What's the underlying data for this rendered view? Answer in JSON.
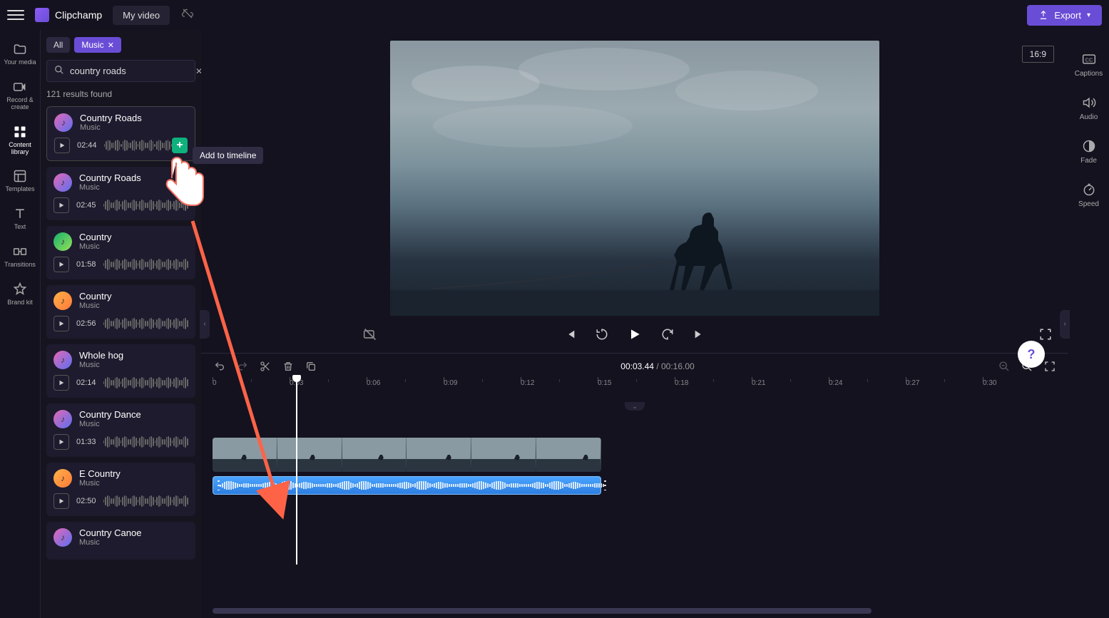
{
  "header": {
    "brand": "Clipchamp",
    "project": "My video",
    "export_label": "Export"
  },
  "left_nav": [
    {
      "label": "Your media",
      "icon": "folder"
    },
    {
      "label": "Record & create",
      "icon": "record"
    },
    {
      "label": "Content library",
      "icon": "library",
      "active": true
    },
    {
      "label": "Templates",
      "icon": "templates"
    },
    {
      "label": "Text",
      "icon": "text"
    },
    {
      "label": "Transitions",
      "icon": "transitions"
    },
    {
      "label": "Brand kit",
      "icon": "brandkit"
    }
  ],
  "library": {
    "chips": {
      "all": "All",
      "music": "Music"
    },
    "search_value": "country roads",
    "results_text": "121 results found",
    "tooltip": "Add to timeline",
    "items": [
      {
        "title": "Country Roads",
        "sub": "Music",
        "duration": "02:44",
        "color": "linear-gradient(135deg,#e568b5,#5b6ff0)",
        "highlighted": true,
        "add_btn": true
      },
      {
        "title": "Country Roads",
        "sub": "Music",
        "duration": "02:45",
        "color": "linear-gradient(135deg,#e568b5,#5b6ff0)"
      },
      {
        "title": "Country",
        "sub": "Music",
        "duration": "01:58",
        "color": "linear-gradient(135deg,#16b06b,#96e05a)"
      },
      {
        "title": "Country",
        "sub": "Music",
        "duration": "02:56",
        "color": "linear-gradient(135deg,#ffb048,#ff7a3a)"
      },
      {
        "title": "Whole hog",
        "sub": "Music",
        "duration": "02:14",
        "color": "linear-gradient(135deg,#e568b5,#5b6ff0)"
      },
      {
        "title": "Country Dance",
        "sub": "Music",
        "duration": "01:33",
        "color": "linear-gradient(135deg,#e568b5,#5b6ff0)"
      },
      {
        "title": "E Country",
        "sub": "Music",
        "duration": "02:50",
        "color": "linear-gradient(135deg,#ffb048,#ff7a3a)"
      },
      {
        "title": "Country Canoe",
        "sub": "Music",
        "duration": "",
        "color": "linear-gradient(135deg,#e568b5,#5b6ff0)"
      }
    ]
  },
  "right_nav": [
    {
      "label": "Captions",
      "icon": "cc"
    },
    {
      "label": "Audio",
      "icon": "speaker"
    },
    {
      "label": "Fade",
      "icon": "fade"
    },
    {
      "label": "Speed",
      "icon": "speed"
    }
  ],
  "preview": {
    "aspect": "16:9"
  },
  "timeline": {
    "current": "00:03.44",
    "total": "00:16.00",
    "ruler": [
      "0",
      "0:03",
      "0:06",
      "0:09",
      "0:12",
      "0:15",
      "0:18",
      "0:21",
      "0:24",
      "0:27",
      "0:30"
    ]
  },
  "help": "?"
}
